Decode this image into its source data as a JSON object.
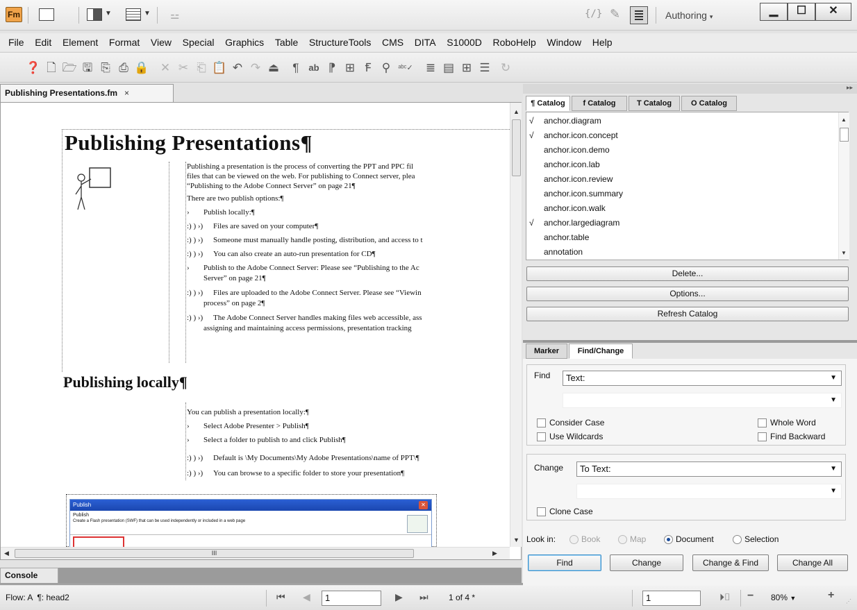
{
  "app": {
    "logo": "Fm",
    "workspace": "Authoring"
  },
  "window_controls": {
    "minimize": "▁",
    "maximize": "☐",
    "close": "✕"
  },
  "menu": [
    "File",
    "Edit",
    "Element",
    "Format",
    "View",
    "Special",
    "Graphics",
    "Table",
    "StructureTools",
    "CMS",
    "DITA",
    "S1000D",
    "RoboHelp",
    "Window",
    "Help"
  ],
  "toolbar_icons": [
    "help-icon",
    "new-icon",
    "open-icon",
    "save-icon",
    "import-icon",
    "print-icon",
    "lock-icon",
    "delete-icon",
    "cut-icon",
    "copy-icon",
    "paste-icon",
    "undo-icon",
    "redo-icon",
    "upload-icon",
    "paragraph-icon",
    "ab-icon",
    "spell-icon",
    "table-icon",
    "text-icon",
    "search-icon",
    "abc-check-icon",
    "align-icon",
    "frame-icon",
    "table-grid-icon",
    "center-icon",
    "refresh-icon"
  ],
  "document": {
    "tab_title": "Publishing Presentations.fm",
    "heading1": "Publishing Presentations¶",
    "para1": [
      "Publishing a presentation is the process of converting the PPT and PPC fil",
      "files that can be viewed on the web. For publishing to Connect server, plea",
      "“Publishing to the Adobe Connect Server” on page 21¶"
    ],
    "para2": "There are two publish options:¶",
    "bullets": [
      {
        "marker": "›",
        "text": "Publish locally:¶"
      },
      {
        "marker": ":) ) ›)",
        "text": "Files are saved on your computer¶"
      },
      {
        "marker": ":) ) ›)",
        "text": "Someone must manually handle posting, distribution, and access to t"
      },
      {
        "marker": ":) ) ›)",
        "text": "You can also create an auto-run presentation for CD¶"
      },
      {
        "marker": "›",
        "text": "Publish to the Adobe Connect Server: Please see “Publishing to the Ac"
      },
      {
        "marker": "",
        "text": "Server” on page 21¶"
      },
      {
        "marker": ":) ) ›)",
        "text": "Files are uploaded to the Adobe Connect Server. Please see “Viewin"
      },
      {
        "marker": "",
        "text": "process” on page 2¶"
      },
      {
        "marker": ":) ) ›)",
        "text": "The Adobe Connect Server handles making files web accessible, ass"
      },
      {
        "marker": "",
        "text": "assigning and maintaining access permissions, presentation tracking"
      }
    ],
    "heading2": "Publishing locally¶",
    "para3": "You can publish a presentation locally:¶",
    "bullets2": [
      {
        "marker": "›",
        "text": "Select Adobe Presenter > Publish¶"
      },
      {
        "marker": "›",
        "text": "Select a folder to publish to and click Publish¶"
      },
      {
        "marker": ":) ) ›)",
        "text": "Default is \\My Documents\\My Adobe Presentations\\name of PPT\\¶"
      },
      {
        "marker": ":) ) ›)",
        "text": "You can browse to a specific folder to store your presentation¶"
      }
    ],
    "screenshot": {
      "title": "Publish",
      "heading": "Publish",
      "desc": "Create a Flash presentation (SWF) that can be used independently or included in a web page"
    },
    "hscroll_label": "III"
  },
  "console_tab": "Console",
  "status": {
    "flow": "Flow: A  ¶: head2",
    "page_value": "1",
    "page_count": "1 of 4 *",
    "nav_value": "1",
    "zoom": "80%"
  },
  "catalog": {
    "tabs": [
      "¶ Catalog",
      "f Catalog",
      "T Catalog",
      "O Catalog"
    ],
    "items": [
      {
        "check": "√",
        "name": "anchor.diagram"
      },
      {
        "check": "√",
        "name": "anchor.icon.concept"
      },
      {
        "check": "",
        "name": "anchor.icon.demo"
      },
      {
        "check": "",
        "name": "anchor.icon.lab"
      },
      {
        "check": "",
        "name": "anchor.icon.review"
      },
      {
        "check": "",
        "name": "anchor.icon.summary"
      },
      {
        "check": "",
        "name": "anchor.icon.walk"
      },
      {
        "check": "√",
        "name": "anchor.largediagram"
      },
      {
        "check": "",
        "name": "anchor.table"
      },
      {
        "check": "",
        "name": "annotation"
      }
    ],
    "buttons": [
      "Delete...",
      "Options...",
      "Refresh Catalog"
    ]
  },
  "find": {
    "tabs": [
      "Marker",
      "Find/Change"
    ],
    "find_label": "Find",
    "find_type": "Text:",
    "find_value": "",
    "consider_case": "Consider Case",
    "whole_word": "Whole Word",
    "use_wildcards": "Use Wildcards",
    "find_backward": "Find Backward",
    "change_label": "Change",
    "change_type": "To Text:",
    "change_value": "",
    "clone_case": "Clone Case",
    "look_in": "Look in:",
    "look_book": "Book",
    "look_map": "Map",
    "look_document": "Document",
    "look_selection": "Selection",
    "btn_find": "Find",
    "btn_change": "Change",
    "btn_change_find": "Change & Find",
    "btn_change_all": "Change All"
  }
}
